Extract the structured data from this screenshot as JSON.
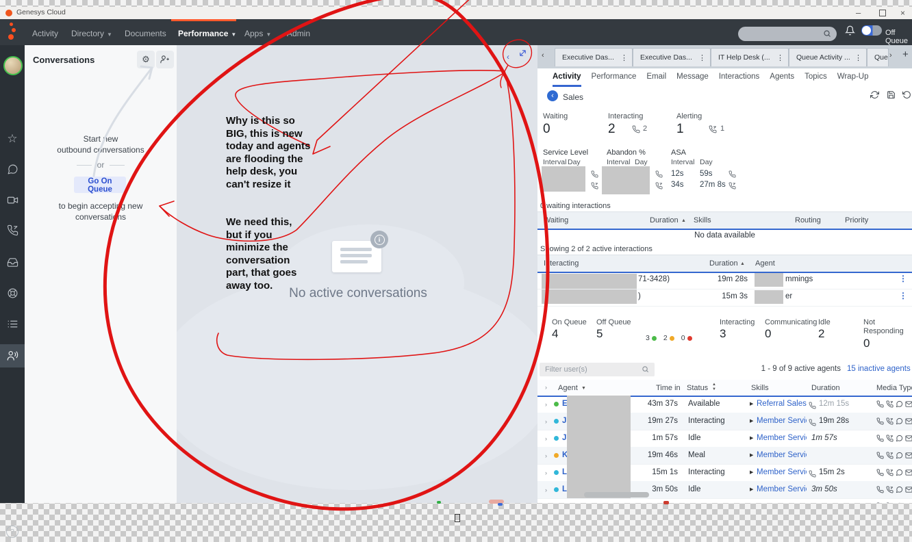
{
  "titlebar": {
    "app_title": "Genesys Cloud"
  },
  "nav": {
    "items": [
      {
        "label": "Activity",
        "dropdown": false,
        "active": false
      },
      {
        "label": "Directory",
        "dropdown": true,
        "active": false
      },
      {
        "label": "Documents",
        "dropdown": false,
        "active": false
      },
      {
        "label": "Performance",
        "dropdown": true,
        "active": true
      },
      {
        "label": "Apps",
        "dropdown": true,
        "active": false
      },
      {
        "label": "Admin",
        "dropdown": false,
        "active": false
      }
    ],
    "off_queue_label": "Off Queue",
    "accent_color": "#ff5a2d"
  },
  "conversations": {
    "title": "Conversations",
    "empty_hint_line1": "Start new",
    "empty_hint_line2": "outbound conversations",
    "or_label": "or",
    "go_on_queue_label": "Go On Queue",
    "accept_line1": "to begin accepting new",
    "accept_line2": "conversations"
  },
  "workspace": {
    "empty_state": "No active conversations"
  },
  "annotations": {
    "color": "#e01414",
    "note1_lines": [
      "Why is this so",
      "BIG, this is new",
      "today and agents",
      "are flooding the",
      "help desk, you",
      "can't resize it"
    ],
    "note2_lines": [
      "We need this,",
      "but if you",
      "minimize the",
      "conversation",
      "part, that goes",
      "away too."
    ]
  },
  "dashboard": {
    "tabs": [
      {
        "label": "Executive Das..."
      },
      {
        "label": "Executive Das..."
      },
      {
        "label": "IT Help Desk (..."
      },
      {
        "label": "Queue Activity ..."
      },
      {
        "label": "Queue."
      }
    ],
    "subtabs": [
      "Activity",
      "Performance",
      "Email",
      "Message",
      "Interactions",
      "Agents",
      "Topics",
      "Wrap-Up"
    ],
    "queue_name": "Sales",
    "stats": {
      "waiting_label": "Waiting",
      "waiting_value": "0",
      "interacting_label": "Interacting",
      "interacting_value": "2",
      "interacting_voice": "2",
      "alerting_label": "Alerting",
      "alerting_value": "1",
      "alerting_voice": "1"
    },
    "metrics": {
      "interval_label": "Interval",
      "day_label": "Day",
      "service_level_label": "Service Level",
      "abandon_label": "Abandon %",
      "asa_label": "ASA",
      "asa_interval_voice": "12s",
      "asa_interval_callback": "34s",
      "asa_day_voice": "59s",
      "asa_day_callback": "27m 8s"
    },
    "waiting_table": {
      "caption": "0 waiting interactions",
      "headers": [
        "Waiting",
        "Duration",
        "Skills",
        "Routing",
        "Priority"
      ],
      "empty_text": "No data available"
    },
    "active_table": {
      "caption": "Showing 2 of 2 active interactions",
      "headers": [
        "Interacting",
        "Duration",
        "Agent"
      ],
      "rows": [
        {
          "interacting_fragment": "71-3428)",
          "duration": "19m 28s",
          "agent_fragment": "mmings"
        },
        {
          "interacting_fragment": ")",
          "duration": "15m 3s",
          "agent_fragment": "er"
        }
      ]
    },
    "agent_stats": {
      "on_queue_label": "On Queue",
      "on_queue_value": "4",
      "off_queue_label": "Off Queue",
      "off_queue_value": "5",
      "presence_counts": [
        {
          "count": "3",
          "color": "#4cbb49"
        },
        {
          "count": "2",
          "color": "#f0a928"
        },
        {
          "count": "0",
          "color": "#e03a2f"
        }
      ],
      "interacting_label": "Interacting",
      "interacting_value": "3",
      "communicating_label": "Communicating",
      "communicating_value": "0",
      "idle_label": "Idle",
      "idle_value": "2",
      "not_responding_label_1": "Not",
      "not_responding_label_2": "Responding",
      "not_responding_value": "0"
    },
    "filter": {
      "placeholder": "Filter user(s)",
      "range_text": "1 - 9 of 9 active agents",
      "inactive_link": "15 inactive agents"
    },
    "agents_table": {
      "headers": {
        "agent": "Agent",
        "time_in": "Time in",
        "status": "Status",
        "skills": "Skills",
        "duration": "Duration",
        "media_types": "Media Types"
      },
      "rows": [
        {
          "initial": "E",
          "presence_color": "#4cbb49",
          "time_in": "43m 37s",
          "status": "Available",
          "skills": "Referral Sales, _",
          "duration": "12m 15s"
        },
        {
          "initial": "J",
          "presence_color": "#31b7d9",
          "time_in": "19m 27s",
          "status": "Interacting",
          "skills": "Member Services",
          "duration": "19m 28s"
        },
        {
          "initial": "J",
          "presence_color": "#31b7d9",
          "time_in": "1m 57s",
          "status": "Idle",
          "skills": "Member Services",
          "duration": "1m 57s"
        },
        {
          "initial": "K",
          "presence_color": "#f0a928",
          "time_in": "19m 46s",
          "status": "Meal",
          "skills": "Member Services",
          "duration": ""
        },
        {
          "initial": "L",
          "presence_color": "#31b7d9",
          "time_in": "15m 1s",
          "status": "Interacting",
          "skills": "Member Services",
          "duration": "15m 2s"
        },
        {
          "initial": "L",
          "presence_color": "#31b7d9",
          "time_in": "3m 50s",
          "status": "Idle",
          "skills": "Member Services",
          "duration": "3m 50s"
        }
      ]
    }
  }
}
